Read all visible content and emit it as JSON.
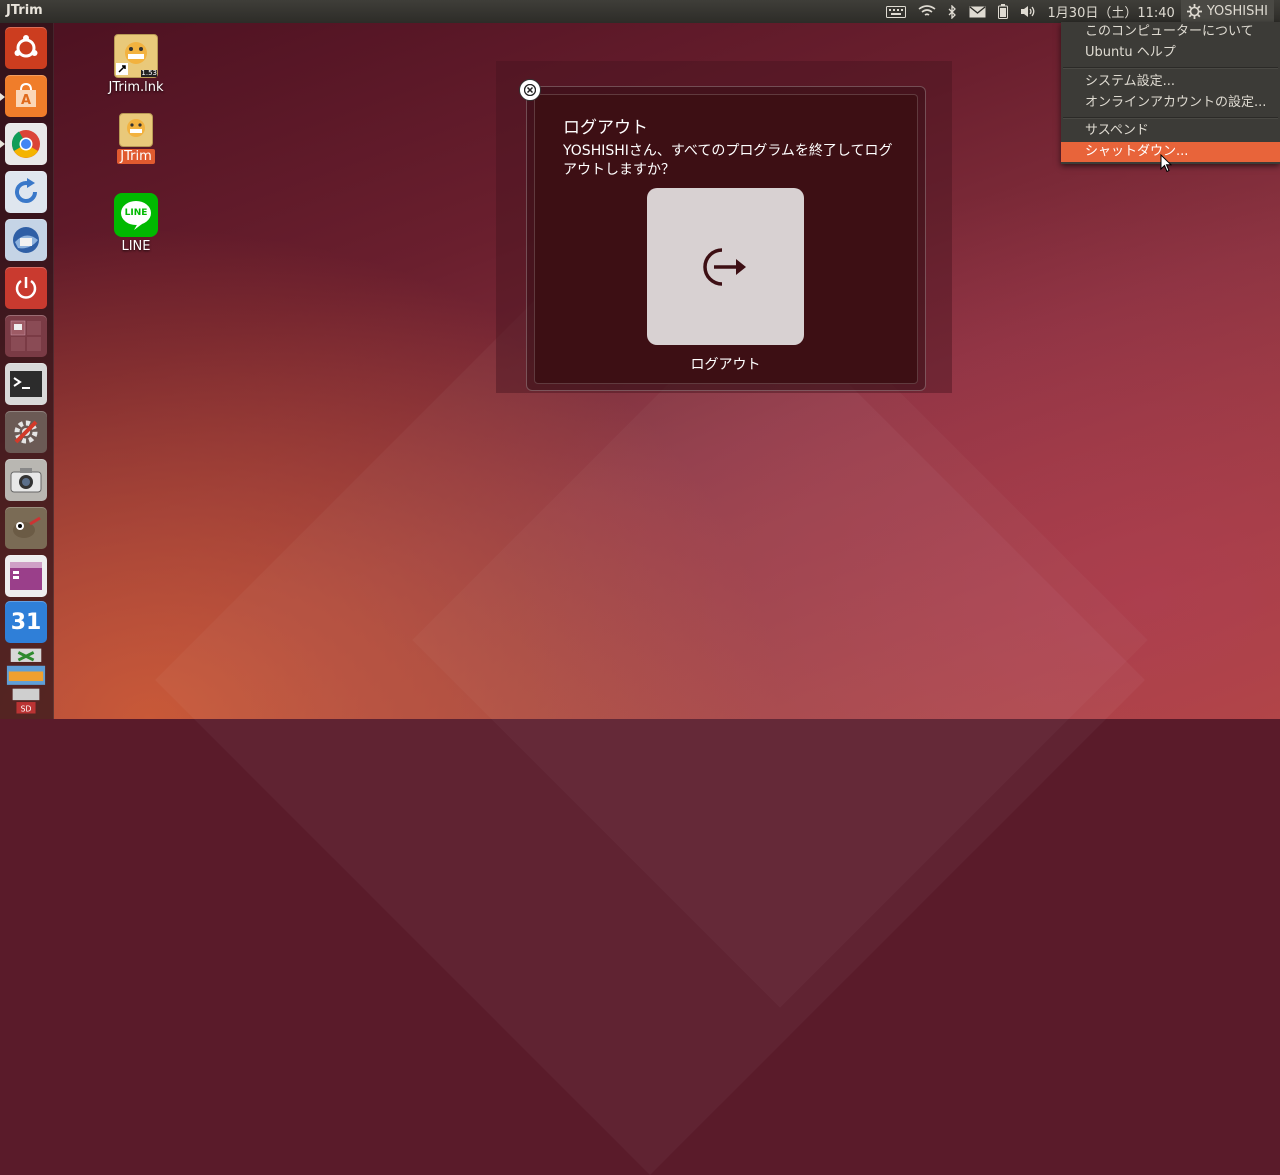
{
  "panel": {
    "app_title": "JTrim",
    "datetime": "1月30日（土）11:40",
    "user": "YOSHISHI",
    "indicators": [
      "keyboard-icon",
      "wifi-icon",
      "bluetooth-icon",
      "mail-icon",
      "battery-icon",
      "volume-icon"
    ]
  },
  "launcher": {
    "items": [
      {
        "name": "dash-home",
        "color": "#cc3d1f"
      },
      {
        "name": "software-center",
        "color": "#f07d2a"
      },
      {
        "name": "chrome",
        "color": "#3b8fdd"
      },
      {
        "name": "updater",
        "color": "#5a8fd1"
      },
      {
        "name": "thunderbird",
        "color": "#3a6cb0"
      },
      {
        "name": "shutdown-app",
        "color": "#c93a2f"
      },
      {
        "name": "workspace-switcher",
        "color": "#7a3b45"
      },
      {
        "name": "terminal",
        "color": "#2d2d2d"
      },
      {
        "name": "system-settings",
        "color": "#6b5a55"
      },
      {
        "name": "camera",
        "color": "#b9b7b2"
      },
      {
        "name": "gimp",
        "color": "#7a6b55"
      },
      {
        "name": "window-app",
        "color": "#9a3f8a"
      },
      {
        "name": "calendar",
        "color": "#2f7fd8",
        "label": "31"
      },
      {
        "name": "stacked-apps",
        "color": "#7a9d5a"
      }
    ]
  },
  "desktop": {
    "icons": [
      {
        "label": "JTrim.lnk",
        "badge": "1.53"
      },
      {
        "label": "JTrim",
        "selected": true
      },
      {
        "label": "LINE",
        "badge": "LINE"
      }
    ]
  },
  "dialog": {
    "title": "ログアウト",
    "message": "YOSHISHIさん、すべてのプログラムを終了してログアウトしますか？",
    "button_label": "ログアウト"
  },
  "menu": {
    "items": [
      {
        "label": "このコンピューターについて"
      },
      {
        "label": "Ubuntu ヘルプ"
      },
      {
        "label": "システム設定..."
      },
      {
        "label": "オンラインアカウントの設定..."
      },
      {
        "label": "サスペンド"
      },
      {
        "label": "シャットダウン...",
        "highlighted": true
      }
    ]
  },
  "colors": {
    "accent": "#e8643a",
    "panel_bg": "#3c3b37",
    "dialog_bg": "#3d0f14"
  }
}
